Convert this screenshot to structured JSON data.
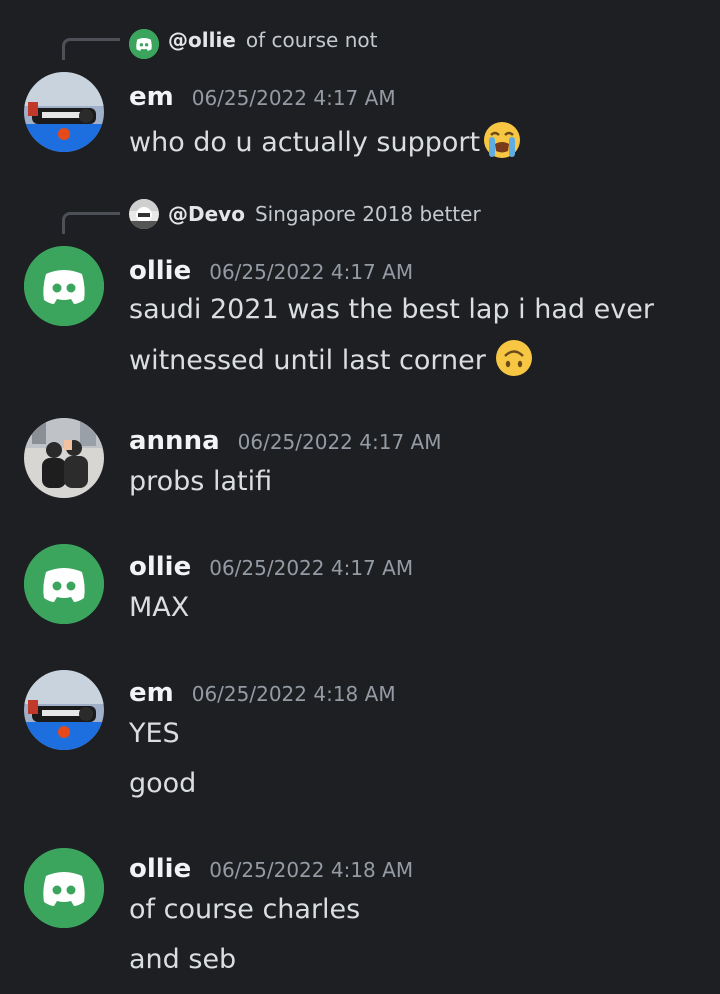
{
  "colors": {
    "background": "#1e1f22",
    "discord_green": "#3ba55d",
    "text": "#dbdee1",
    "timestamp": "#949ba4"
  },
  "replies": [
    {
      "author": "@ollie",
      "text": "of course not",
      "avatar_icon": "discord-logo-icon"
    },
    {
      "author": "@Devo",
      "text": "Singapore 2018 better",
      "avatar_icon": "devo-avatar"
    }
  ],
  "messages": [
    {
      "author": "em",
      "timestamp": "06/25/2022 4:17 AM",
      "lines": [
        "who do u actually support"
      ],
      "emoji": "loudly-crying-face-icon"
    },
    {
      "author": "ollie",
      "timestamp": "06/25/2022 4:17 AM",
      "lines": [
        "saudi 2021 was the best lap i had ever",
        "witnessed until last corner"
      ],
      "emoji": "upside-down-face-icon"
    },
    {
      "author": "annna",
      "timestamp": "06/25/2022 4:17 AM",
      "lines": [
        "probs latifi"
      ]
    },
    {
      "author": "ollie",
      "timestamp": "06/25/2022 4:17 AM",
      "lines": [
        "MAX"
      ]
    },
    {
      "author": "em",
      "timestamp": "06/25/2022 4:18 AM",
      "lines": [
        "YES",
        "good"
      ]
    },
    {
      "author": "ollie",
      "timestamp": "06/25/2022 4:18 AM",
      "lines": [
        "of course charles",
        "and seb"
      ]
    }
  ]
}
